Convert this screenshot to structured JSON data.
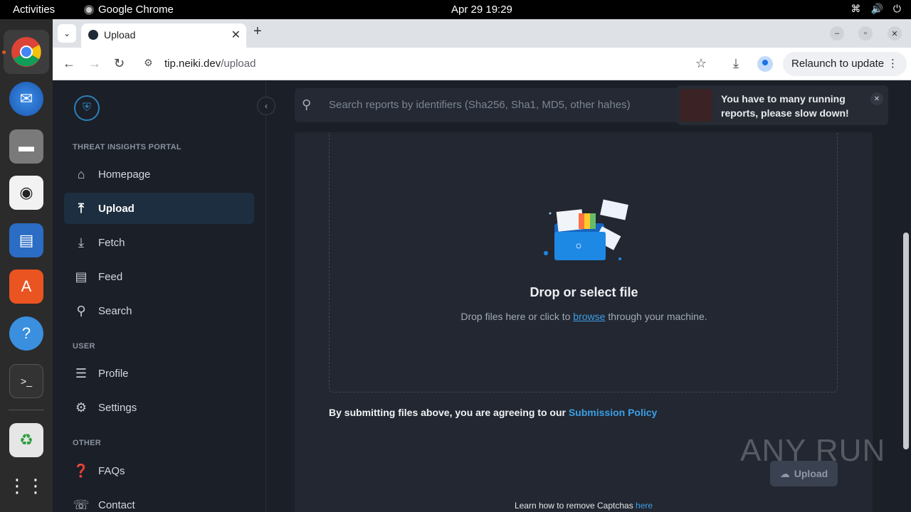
{
  "system": {
    "activities": "Activities",
    "app_name": "Google Chrome",
    "clock": "Apr 29  19:29"
  },
  "browser": {
    "tab_title": "Upload",
    "url_host": "tip.neiki.dev",
    "url_path": "/upload",
    "relaunch_label": "Relaunch to update"
  },
  "sidebar": {
    "sections": {
      "portal": "THREAT INSIGHTS PORTAL",
      "user": "USER",
      "other": "OTHER"
    },
    "items": [
      {
        "label": "Homepage",
        "icon": "home-icon"
      },
      {
        "label": "Upload",
        "icon": "upload-icon"
      },
      {
        "label": "Fetch",
        "icon": "fetch-icon"
      },
      {
        "label": "Feed",
        "icon": "feed-icon"
      },
      {
        "label": "Search",
        "icon": "search-icon"
      },
      {
        "label": "Profile",
        "icon": "profile-icon"
      },
      {
        "label": "Settings",
        "icon": "gear-icon"
      },
      {
        "label": "FAQs",
        "icon": "faq-icon"
      },
      {
        "label": "Contact",
        "icon": "contact-icon"
      }
    ]
  },
  "search": {
    "placeholder": "Search reports by identifiers (Sha256, Sha1, MD5, other hahes)"
  },
  "toast": {
    "message": "You have to many running reports, please slow down!"
  },
  "upload": {
    "title": "Drop or select file",
    "sub_before": "Drop files here or click to ",
    "sub_link": "browse",
    "sub_after": " through your machine.",
    "policy_text": "By submitting files above, you are agreeing to our ",
    "policy_link": "Submission Policy",
    "button_label": "Upload",
    "captcha_text": "Learn how to remove Captchas ",
    "captcha_link": "here"
  },
  "watermark": "ANY RUN"
}
